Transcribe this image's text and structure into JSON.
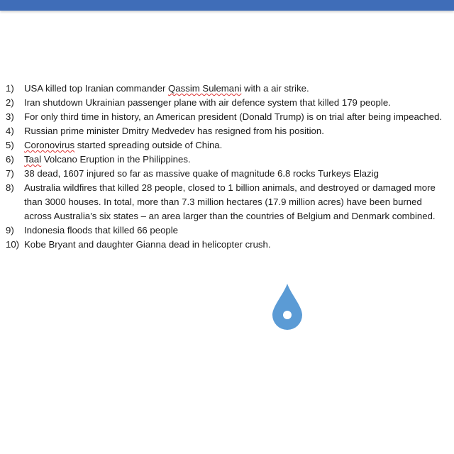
{
  "colors": {
    "top_bar": "#3f6db8",
    "drop": "#5b9bd5",
    "spellcheck": "#dd3333"
  },
  "list": [
    {
      "num": "1)",
      "pre": "USA killed top Iranian commander ",
      "flag": "Qassim Sulemani",
      "post": " with a  air strike."
    },
    {
      "num": "2)",
      "pre": "Iran shutdown Ukrainian passenger plane with air defence system that killed 179 people.",
      "flag": "",
      "post": ""
    },
    {
      "num": "3)",
      "pre": "For only third time in history, an American president (Donald Trump) is on trial after being impeached.",
      "flag": "",
      "post": ""
    },
    {
      "num": "4)",
      "pre": "Russian prime minister Dmitry Medvedev has resigned from his position.",
      "flag": "",
      "post": ""
    },
    {
      "num": "5)",
      "pre": "",
      "flag": "Coronovirus",
      "post": " started spreading outside of China."
    },
    {
      "num": "6)",
      "pre": "",
      "flag": "Taal",
      "post": " Volcano Eruption in the Philippines."
    },
    {
      "num": "7)",
      "pre": "38 dead, 1607 injured so far as massive quake of magnitude 6.8 rocks Turkeys Elazig",
      "flag": "",
      "post": ""
    },
    {
      "num": "8)",
      "pre": "Australia wildfires that killed 28 people, closed to 1 billion animals, and destroyed or damaged more than 3000 houses. In total, more than 7.3 million hectares (17.9 million acres) have been burned across Australia’s six states – an area larger than the countries of Belgium and Denmark combined.",
      "flag": "",
      "post": ""
    },
    {
      "num": "9)",
      "pre": "Indonesia floods that killed 66 people",
      "flag": "",
      "post": ""
    },
    {
      "num": "10)",
      "pre": "Kobe Bryant and daughter Gianna dead in helicopter crush.",
      "flag": "",
      "post": ""
    }
  ],
  "icon": "water-drop-icon"
}
